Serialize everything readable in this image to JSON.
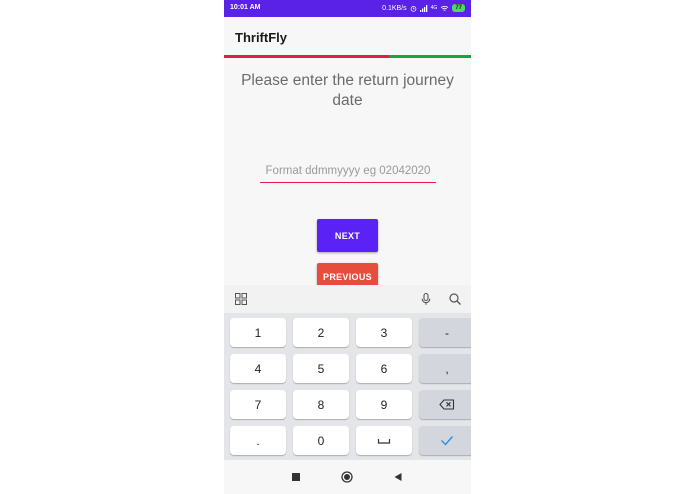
{
  "status_bar": {
    "time": "10:01 AM",
    "speed": "0.1KB/s",
    "network": "4G",
    "battery": "77"
  },
  "app_bar": {
    "title": "ThriftFly"
  },
  "progress": {
    "fraction": 0.67,
    "fill_color": "#e11d48",
    "track_color": "#16a34a"
  },
  "form": {
    "prompt": "Please enter the return journey date",
    "date_input": {
      "placeholder": "Format ddmmyyyy eg 02042020",
      "value": ""
    },
    "next_label": "NEXT",
    "previous_label": "PREVIOUS"
  },
  "keyboard": {
    "toolbar_icons": [
      "grid-icon",
      "microphone-icon",
      "search-icon"
    ],
    "rows": [
      [
        "1",
        "2",
        "3",
        "-"
      ],
      [
        "4",
        "5",
        "6",
        ","
      ],
      [
        "7",
        "8",
        "9",
        "backspace-icon"
      ],
      [
        ".",
        "0",
        "space-icon",
        "checkmark-icon"
      ]
    ]
  },
  "nav_bar": {
    "icons": [
      "recents-square-icon",
      "home-circle-icon",
      "back-triangle-icon"
    ]
  },
  "colors": {
    "accent": "#5a22f5",
    "danger": "#e74c3c",
    "status_bar": "#5a22e6"
  }
}
